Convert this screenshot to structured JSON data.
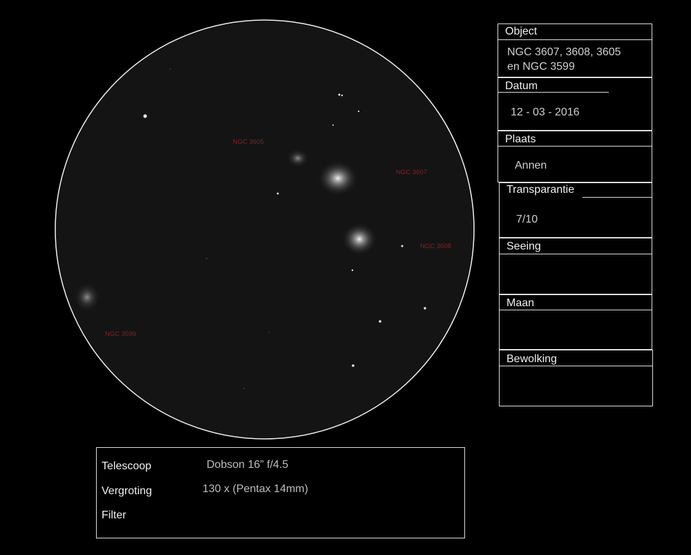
{
  "labels": {
    "ngc3605": "NGC 3605",
    "ngc3607": "NGC 3607",
    "ngc3608": "NGC 3608",
    "ngc3599": "NGC 3599"
  },
  "info": {
    "object_label": "Object",
    "object_value_line1": "NGC 3607, 3608, 3605",
    "object_value_line2": "en NGC 3599",
    "datum_label": "Datum",
    "datum_value": "12 - 03 - 2016",
    "plaats_label": "Plaats",
    "plaats_value": "Annen",
    "transparantie_label": "Transparantie",
    "transparantie_value": "7/10",
    "seeing_label": "Seeing",
    "maan_label": "Maan",
    "bewolking_label": "Bewolking"
  },
  "equipment": {
    "telescoop_label": "Telescoop",
    "telescoop_value": "Dobson 16” f/4.5",
    "vergroting_label": "Vergroting",
    "vergroting_value": "130 x (Pentax 14mm)",
    "filter_label": "Filter"
  },
  "colors": {
    "field_fill": "#141414",
    "label_red": "#8a1f1f",
    "border": "#dddddd"
  }
}
